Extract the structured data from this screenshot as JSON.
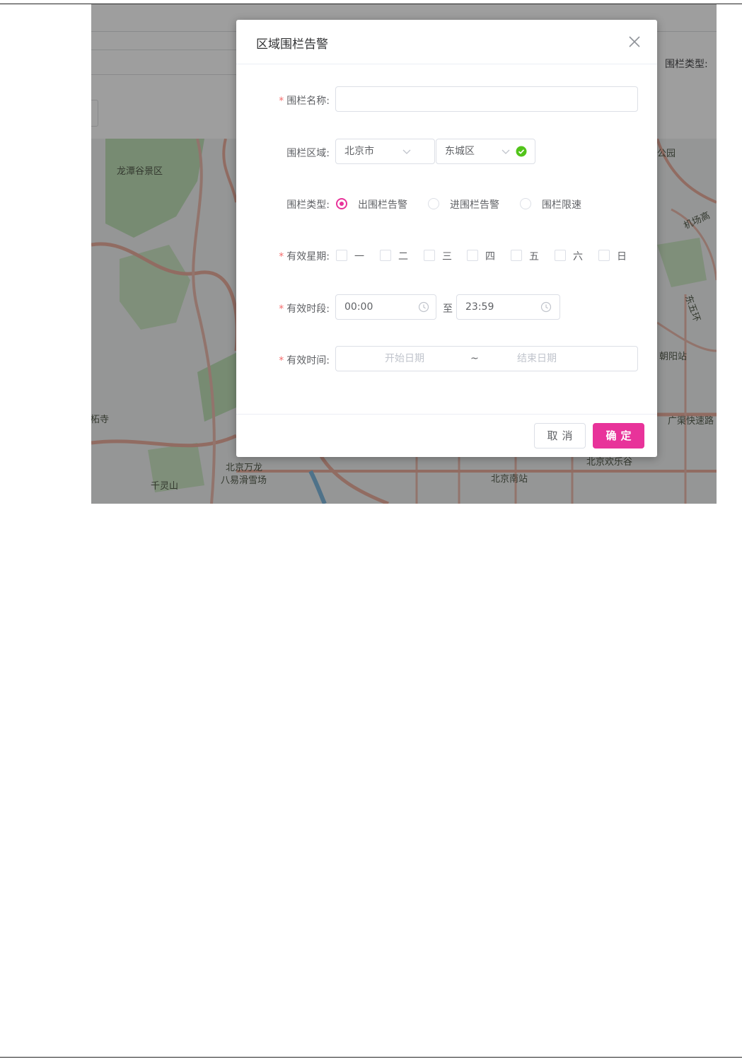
{
  "dialog": {
    "title": "区域围栏告警",
    "close_icon": "close-icon",
    "fields": {
      "name": {
        "label": "围栏名称:",
        "required": true,
        "value": "",
        "placeholder": ""
      },
      "region": {
        "label": "围栏区域:",
        "province": "北京市",
        "district": "东城区",
        "valid_icon": "check-circle-icon"
      },
      "type": {
        "label": "围栏类型:",
        "options": [
          "出围栏告警",
          "进围栏告警",
          "围栏限速"
        ],
        "selected": "出围栏告警"
      },
      "weekdays": {
        "label": "有效星期:",
        "required": true,
        "options": [
          "一",
          "二",
          "三",
          "四",
          "五",
          "六",
          "日"
        ]
      },
      "time_range": {
        "label": "有效时段:",
        "required": true,
        "start": "00:00",
        "separator": "至",
        "end": "23:59",
        "icon": "clock-icon"
      },
      "date_range": {
        "label": "有效时间:",
        "required": true,
        "start_placeholder": "开始日期",
        "separator": "~",
        "end_placeholder": "结束日期"
      }
    },
    "buttons": {
      "cancel": "取消",
      "ok": "确定"
    }
  },
  "background": {
    "filter_label": "围栏类型:",
    "map_labels": [
      "龙潭谷景区",
      "公园",
      "机场高",
      "东五环",
      "朝阳站",
      "广渠快速路",
      "北京欢乐谷",
      "北京南站",
      "北京万龙",
      "八易滑雪场",
      "千灵山",
      "潭柘寺"
    ]
  },
  "colors": {
    "accent": "#e8339a",
    "required": "#f56c6c",
    "success": "#52c41a"
  }
}
